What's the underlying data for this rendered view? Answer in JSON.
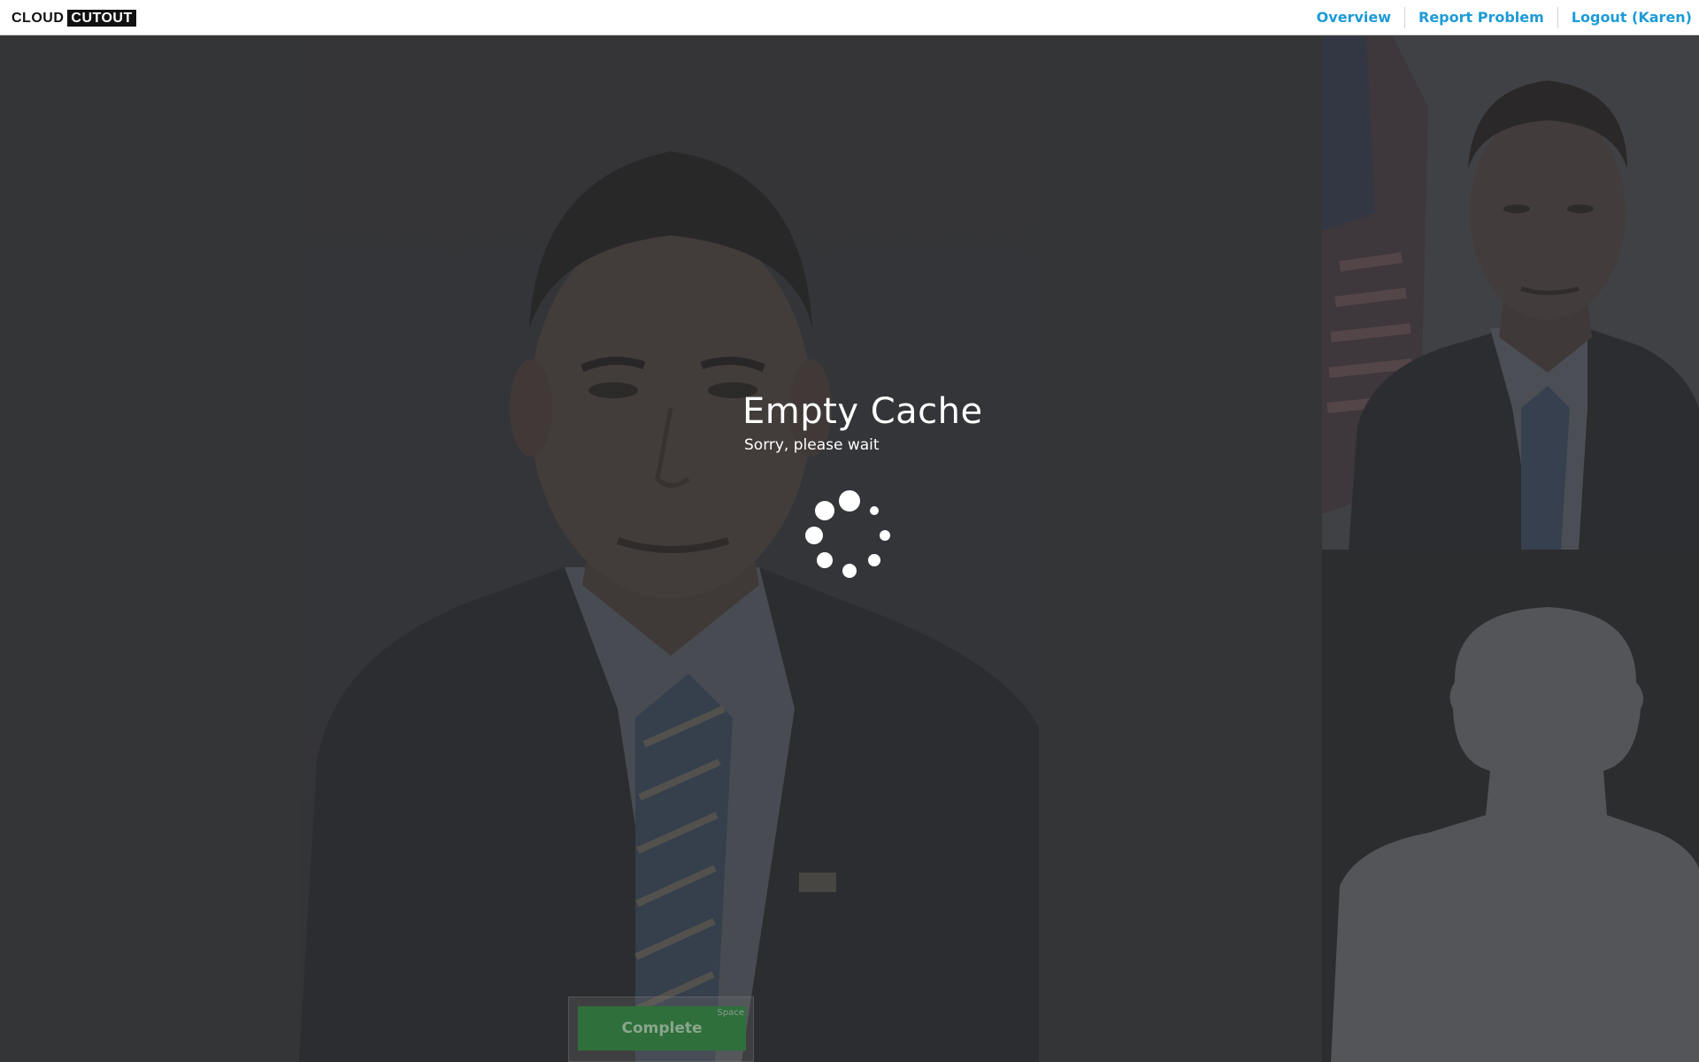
{
  "app": {
    "logo_part1": "CLOUD",
    "logo_part2": "CUTOUT"
  },
  "nav": {
    "items": [
      {
        "label": "Overview"
      },
      {
        "label": "Report Problem"
      },
      {
        "label": "Logout (Karen)"
      }
    ]
  },
  "modal": {
    "title": "Empty Cache",
    "subtitle": "Sorry, please wait"
  },
  "editor": {
    "complete_label": "Complete",
    "complete_shortcut": "Space"
  },
  "colors": {
    "nav_link": "#1e9bd7",
    "complete_button": "#2f6f3b",
    "overlay": "#28282a"
  },
  "icons": {
    "spinner": "loading-spinner-icon"
  }
}
